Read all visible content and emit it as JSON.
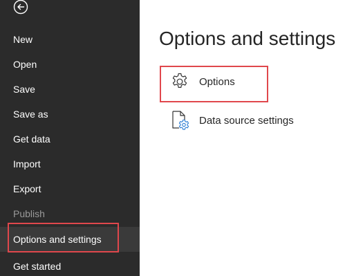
{
  "sidebar": {
    "back_icon": "back-arrow-icon",
    "items": [
      {
        "label": "New",
        "state": "normal"
      },
      {
        "label": "Open",
        "state": "normal"
      },
      {
        "label": "Save",
        "state": "normal"
      },
      {
        "label": "Save as",
        "state": "normal"
      },
      {
        "label": "Get data",
        "state": "normal"
      },
      {
        "label": "Import",
        "state": "normal"
      },
      {
        "label": "Export",
        "state": "normal"
      },
      {
        "label": "Publish",
        "state": "disabled"
      },
      {
        "label": "Options and settings",
        "state": "active"
      },
      {
        "label": "Get started",
        "state": "normal"
      }
    ]
  },
  "main": {
    "title": "Options and settings",
    "options": [
      {
        "label": "Options",
        "icon": "gear-icon"
      },
      {
        "label": "Data source settings",
        "icon": "document-gear-icon"
      }
    ]
  },
  "colors": {
    "sidebar_bg": "#2b2b2b",
    "highlight_border": "#e0474c",
    "text_dark": "#252525",
    "disabled_text": "#9a9a9a"
  }
}
